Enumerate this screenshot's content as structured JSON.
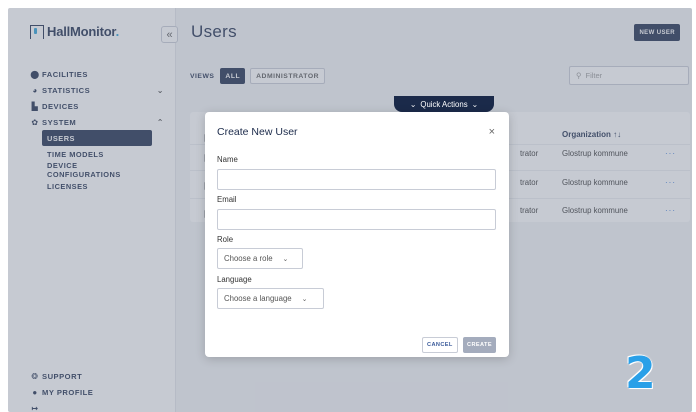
{
  "app": {
    "logo": "HallMonitor",
    "logo_dot": "."
  },
  "sidebar": {
    "collapse_icon": "«",
    "items": [
      {
        "label": "FACILITIES",
        "icon": "map-pin-icon"
      },
      {
        "label": "STATISTICS",
        "icon": "pie-icon",
        "expandable": true
      },
      {
        "label": "DEVICES",
        "icon": "devices-icon"
      },
      {
        "label": "SYSTEM",
        "icon": "gear-icon",
        "expandable": true
      }
    ],
    "system_subitems": [
      {
        "label": "USERS",
        "active": true
      },
      {
        "label": "TIME MODELS"
      },
      {
        "label": "DEVICE CONFIGURATIONS"
      },
      {
        "label": "LICENSES"
      }
    ],
    "bottom": [
      {
        "label": "SUPPORT",
        "icon": "support-icon"
      },
      {
        "label": "MY PROFILE",
        "icon": "user-icon"
      },
      {
        "label": "",
        "icon": "logout-icon"
      }
    ]
  },
  "header": {
    "title": "Users",
    "new_user": "NEW USER"
  },
  "views": {
    "label": "VIEWS",
    "options": [
      "ALL",
      "ADMINISTRATOR"
    ],
    "selected": "ALL"
  },
  "filter": {
    "placeholder": "Filter"
  },
  "quick_actions": {
    "label": "Quick Actions"
  },
  "table": {
    "organization_header": "Organization",
    "sort_icon": "↑↓",
    "rows": [
      {
        "role": "trator",
        "organization": "Glostrup kommune",
        "actions": "···"
      },
      {
        "role": "trator",
        "organization": "Glostrup kommune",
        "actions": "···"
      },
      {
        "role": "trator",
        "organization": "Glostrup kommune",
        "actions": "···"
      }
    ]
  },
  "modal": {
    "title": "Create New User",
    "close": "×",
    "fields": {
      "name_label": "Name",
      "name_value": "",
      "email_label": "Email",
      "email_value": "",
      "role_label": "Role",
      "role_placeholder": "Choose a role",
      "language_label": "Language",
      "language_placeholder": "Choose a language"
    },
    "cancel": "CANCEL",
    "create": "CREATE"
  },
  "step_badge": "2",
  "colors": {
    "navy": "#1b2a4a",
    "accent": "#2aa0d8",
    "link": "#2a6fd6"
  }
}
